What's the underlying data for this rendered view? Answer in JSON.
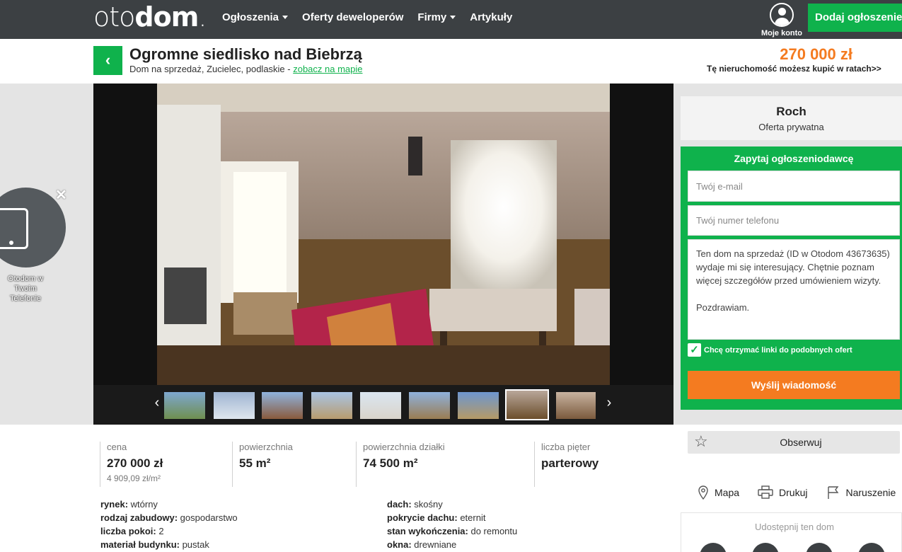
{
  "nav": {
    "logo_light": "oto",
    "logo_bold": "dom",
    "logo_dot": ".",
    "items": [
      {
        "label": "Ogłoszenia",
        "dropdown": true
      },
      {
        "label": "Oferty deweloperów",
        "dropdown": false
      },
      {
        "label": "Firmy",
        "dropdown": true
      },
      {
        "label": "Artykuły",
        "dropdown": false
      }
    ],
    "account_label": "Moje konto",
    "add_button": "Dodaj ogłoszenie"
  },
  "listing": {
    "title": "Ogromne siedlisko nad Biebrzą",
    "subtitle": "Dom na sprzedaż, Zucielec, podlaskie - ",
    "map_link": "zobacz na mapie",
    "price": "270 000 zł",
    "installments": "Tę nieruchomość możesz kupić w ratach>>"
  },
  "promo": {
    "label": "Otodom w Twoim Telefonie",
    "close": "✕"
  },
  "gallery": {
    "prev_arrow": "‹",
    "next_arrow": "›",
    "thumb_count": 9,
    "active_thumb": 8
  },
  "seller": {
    "name": "Roch",
    "type": "Oferta prywatna"
  },
  "contact_form": {
    "title": "Zapytaj ogłoszeniodawcę",
    "email_placeholder": "Twój e-mail",
    "phone_placeholder": "Twój numer telefonu",
    "message": "Ten dom na sprzedaż (ID w Otodom 43673635) wydaje mi się interesujący. Chętnie poznam więcej szczegółów przed umówieniem wizyty.\n\nPozdrawiam.",
    "checkbox_label": "Chcę otrzymać linki do podobnych ofert",
    "checkbox_checked": true,
    "send_button": "Wyślij wiadomość"
  },
  "observe_button": "Obserwuj",
  "actions": [
    {
      "label": "Mapa",
      "icon": "map-pin-icon"
    },
    {
      "label": "Drukuj",
      "icon": "printer-icon"
    },
    {
      "label": "Naruszenie",
      "icon": "flag-icon"
    }
  ],
  "share_label": "Udostępnij ten dom",
  "stats": [
    {
      "label": "cena",
      "value": "270 000 zł",
      "sub": "4 909,09 zł/m²"
    },
    {
      "label": "powierzchnia",
      "value": "55 m²",
      "sub": ""
    },
    {
      "label": "powierzchnia działki",
      "value": "74 500 m²",
      "sub": ""
    },
    {
      "label": "liczba pięter",
      "value": "parterowy",
      "sub": ""
    }
  ],
  "details_left": [
    {
      "key": "rynek:",
      "value": " wtórny"
    },
    {
      "key": "rodzaj zabudowy:",
      "value": " gospodarstwo"
    },
    {
      "key": "liczba pokoi:",
      "value": " 2"
    },
    {
      "key": "materiał budynku:",
      "value": " pustak"
    }
  ],
  "details_right": [
    {
      "key": "dach:",
      "value": " skośny"
    },
    {
      "key": "pokrycie dachu:",
      "value": " eternit"
    },
    {
      "key": "stan wykończenia:",
      "value": " do remontu"
    },
    {
      "key": "okna:",
      "value": " drewniane"
    }
  ],
  "colors": {
    "brand_green": "#0fb24c",
    "price_orange": "#f47b20",
    "topbar": "#3c4043"
  }
}
